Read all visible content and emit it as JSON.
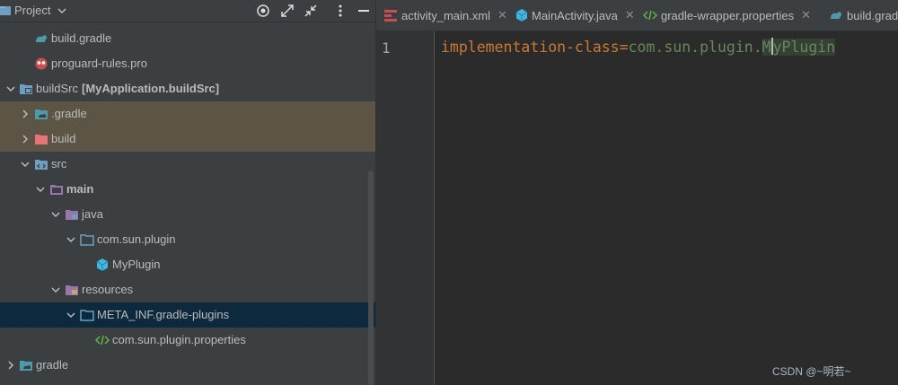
{
  "project_panel": {
    "title": "Project",
    "tree": [
      {
        "label": "build.gradle"
      },
      {
        "label": "proguard-rules.pro"
      },
      {
        "label": "buildSrc",
        "extra": "[MyApplication.buildSrc]"
      },
      {
        "label": ".gradle"
      },
      {
        "label": "build"
      },
      {
        "label": "src"
      },
      {
        "label": "main"
      },
      {
        "label": "java"
      },
      {
        "label": "com.sun.plugin"
      },
      {
        "label": "MyPlugin"
      },
      {
        "label": "resources"
      },
      {
        "label": "META_INF.gradle-plugins"
      },
      {
        "label": "com.sun.plugin.properties"
      },
      {
        "label": "gradle"
      }
    ]
  },
  "tabs": [
    {
      "label": "activity_main.xml"
    },
    {
      "label": "MainActivity.java"
    },
    {
      "label": "gradle-wrapper.properties"
    },
    {
      "label": "build.grad"
    }
  ],
  "editor": {
    "line_number": "1",
    "key": "implementation-class",
    "eq": "=",
    "value_prefix": "com.sun.plugin.",
    "value_before_caret": "M",
    "value_after_caret": "yPlugin"
  },
  "watermark": "CSDN @~明若~",
  "colors": {
    "selection": "#0d293e",
    "excluded": "#5c5546",
    "keyword": "#cc7832",
    "string": "#6a8759"
  }
}
